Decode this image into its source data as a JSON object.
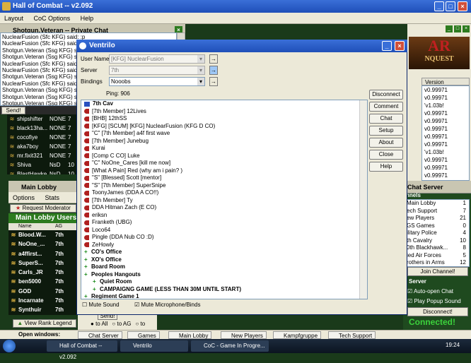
{
  "main_window": {
    "title": "Hall of Combat -- v2.092",
    "menu": [
      "Layout",
      "CoC Options",
      "Help"
    ]
  },
  "private_chat": {
    "title": "Shotgun.Veteran -- Private Chat",
    "lines": [
      "NuclearFusion (Sfc KFG) said: :p",
      "NuclearFusion (Sfc KFG) said: lau",
      "Shotgun.Veteran (Ssg KFG) said:",
      "Shotgun.Veteran (Ssg KFG) said:",
      "NuclearFusion (Sfc KFG) said: con",
      "NuclearFusion (Sfc KFG) said: lol",
      "Shotgun.Veteran (Ssg KFG) said:",
      "NuclearFusion (Sfc KFG) said: o",
      "Shotgun.Veteran (Ssg KFG) said:",
      "Shotgun.Veteran (Ssg KFG) said: bot",
      "Shotgun.Veteran (Ssg KFG) said:"
    ],
    "send_label": "Send!"
  },
  "team_list": {
    "rows": [
      {
        "name": "shipshifter",
        "col2": "NONE",
        "col3": "7"
      },
      {
        "name": "black13ha...",
        "col2": "NONE",
        "col3": "7"
      },
      {
        "name": "cocofiye",
        "col2": "NONE",
        "col3": "7"
      },
      {
        "name": "aka7boy",
        "col2": "NONE",
        "col3": "7"
      },
      {
        "name": "mr.fixit321",
        "col2": "NONE",
        "col3": "7"
      },
      {
        "name": "Shiva",
        "col2": "NsD",
        "col3": "10"
      },
      {
        "name": "BlastHawke",
        "col2": "NsD",
        "col3": "10"
      }
    ]
  },
  "main_lobby": {
    "title": "Main Lobby",
    "menu": [
      "Options",
      "Stats"
    ],
    "request_moderator": "Request Moderator",
    "users_header": "Main Lobby Users",
    "col_name": "Name",
    "col_ag": "AG",
    "users": [
      {
        "name": "Blood.W...",
        "ag": "7th"
      },
      {
        "name": "NoOne_...",
        "ag": "7th"
      },
      {
        "name": "a4ffirst...",
        "ag": "7th"
      },
      {
        "name": "SuperS...",
        "ag": "7th"
      },
      {
        "name": "Carls_JR",
        "ag": "7th"
      },
      {
        "name": "ben5000",
        "ag": "7th"
      },
      {
        "name": "GOD",
        "ag": "7th"
      },
      {
        "name": "Incarnate",
        "ag": "7th"
      },
      {
        "name": "Synthuir",
        "ag": "7th"
      }
    ],
    "view_rank_legend": "View Rank Legend",
    "send_label": "Send!",
    "radio_all": "to All",
    "radio_ag": "to AG",
    "radio_to": "to"
  },
  "version_panel": {
    "header": "Version",
    "values": [
      "v0.99971",
      "v0.99971",
      "'v1.03b!",
      "v0.99971",
      "v0.99971",
      "v0.99971",
      "v0.99971",
      "v0.99971",
      "'v1.03b!",
      "v0.99971",
      "v0.99971",
      "v0.99971"
    ]
  },
  "banner": {
    "line1": "AR",
    "line2": "NQUEST"
  },
  "chat_server": {
    "title": "Chat Server",
    "channels_label": "nnels",
    "channels": [
      {
        "name": "Main Lobby",
        "count": "1"
      },
      {
        "name": "ech Support",
        "count": "7"
      },
      {
        "name": "ew Players",
        "count": "21"
      },
      {
        "name": "GS Games",
        "count": "0"
      },
      {
        "name": "ilitary Police",
        "count": "4"
      },
      {
        "name": "th Cavalry",
        "count": "10"
      },
      {
        "name": "0th Blackhawk...",
        "count": "8"
      },
      {
        "name": "ied Air Forces",
        "count": "5"
      },
      {
        "name": "rothers in Arms",
        "count": "12"
      }
    ],
    "join_label": "Join Channel!",
    "server_label": "Server",
    "auto_open": "Auto-open Chat",
    "play_popup": "Play Popup Sound",
    "disconnect": "Disconnect!",
    "connected": "Connected!"
  },
  "ventrilo": {
    "title": "Ventrilo",
    "user_name_label": "User Name",
    "user_name_value": "[KFG] NuclearFusion",
    "server_label": "Server",
    "server_value": "7th",
    "bindings_label": "Bindings",
    "bindings_value": "Nooobs",
    "ping": "Ping: 906",
    "buttons": [
      "Disconnect",
      "Comment",
      "Chat",
      "Setup",
      "About",
      "Close",
      "Help"
    ],
    "mute_sound": "Mute Sound",
    "mute_mic": "Mute Microphone/Binds",
    "tree": [
      {
        "type": "server",
        "text": "7th Cav",
        "indent": 0
      },
      {
        "type": "user",
        "text": "[7th Member] 12Lives",
        "indent": 0
      },
      {
        "type": "user",
        "text": "[BHB] 12thSS",
        "indent": 0
      },
      {
        "type": "user",
        "text": "[KFG] [SCUM] [KFG] NuclearFusion (KFG D CO)",
        "indent": 0
      },
      {
        "type": "user",
        "text": "\"C\" [7th Member] a4f first wave",
        "indent": 0
      },
      {
        "type": "user",
        "text": "[7th Member] Junebug",
        "indent": 0
      },
      {
        "type": "user",
        "text": "Kurai",
        "indent": 0
      },
      {
        "type": "user",
        "text": "[Comp C  CO] Luke",
        "indent": 0
      },
      {
        "type": "user",
        "text": "\"C\" NoOne_Cares [kill me now]",
        "indent": 0
      },
      {
        "type": "user",
        "text": "[What A Pain] Red (why am i pain? )",
        "indent": 0
      },
      {
        "type": "user",
        "text": "\"S\" [Blessed] Scott [mentor]",
        "indent": 0
      },
      {
        "type": "user",
        "text": "\"S\" [7th Member] SuperSnipe",
        "indent": 0
      },
      {
        "type": "user",
        "text": "ToonyJames (DDA A CO!!)",
        "indent": 0
      },
      {
        "type": "user",
        "text": "[7th Member] Ty",
        "indent": 0
      },
      {
        "type": "user",
        "text": "DDA Hitman Zach (E CO)",
        "indent": 0
      },
      {
        "type": "user",
        "text": "eriksn",
        "indent": 0
      },
      {
        "type": "user",
        "text": "Franketh (UBG)",
        "indent": 0
      },
      {
        "type": "user",
        "text": "Loco64",
        "indent": 0
      },
      {
        "type": "user",
        "text": "Pingle (DDA Nub CO :D)",
        "indent": 0
      },
      {
        "type": "user",
        "text": "ZeHowly",
        "indent": 0
      },
      {
        "type": "channel",
        "text": "CO's Office",
        "indent": 0
      },
      {
        "type": "channel",
        "text": "XO's Office",
        "indent": 0
      },
      {
        "type": "channel",
        "text": "Board Room",
        "indent": 0
      },
      {
        "type": "channel",
        "text": "Peoples Hangouts",
        "indent": 0
      },
      {
        "type": "channel",
        "text": "Quiet Room",
        "indent": 1
      },
      {
        "type": "channel",
        "text": "CAMPAIGNG GAME (LESS THAN 30M UNTIL START)",
        "indent": 1
      },
      {
        "type": "channel",
        "text": "Regiment Game 1",
        "indent": 0
      }
    ]
  },
  "open_windows": {
    "label": "Open windows:",
    "items": [
      "Chat Server",
      "Games",
      "Main Lobby",
      "New Players",
      "Kampfgruppe",
      "Tech Support"
    ]
  },
  "taskbar": {
    "items": [
      "Hall of Combat -- v2.092",
      "Ventrilo",
      "CoC - Game In Progre..."
    ],
    "clock": "19:24"
  }
}
